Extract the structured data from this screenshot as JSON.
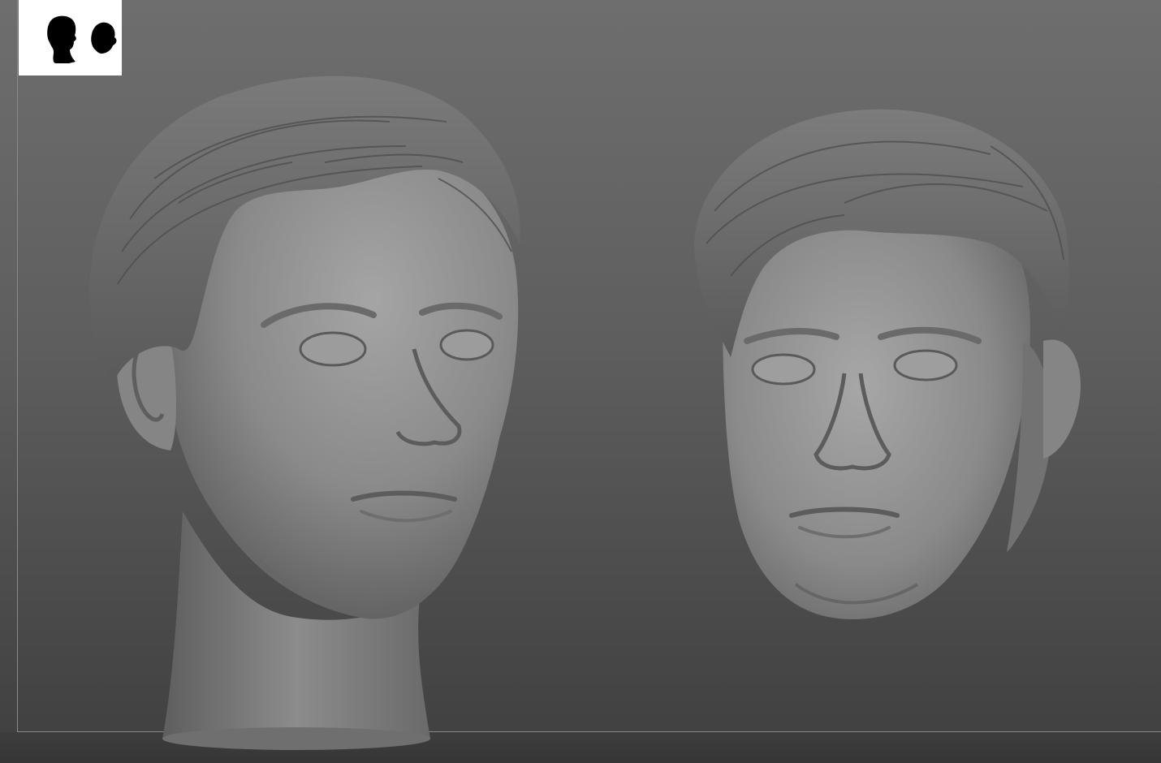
{
  "viewport": {
    "background_top": "#6e6e6e",
    "background_bottom": "#3f3f3f",
    "frame_color": "#8a8a8a"
  },
  "thumbnail": {
    "icon": "head-silhouettes-icon",
    "background": "#ffffff",
    "silhouette_color": "#000000"
  },
  "models": [
    {
      "name": "full-head-bust",
      "view": "three-quarter",
      "material_color": "#8c8c8c"
    },
    {
      "name": "face-mask",
      "view": "front",
      "material_color": "#8c8c8c"
    }
  ]
}
